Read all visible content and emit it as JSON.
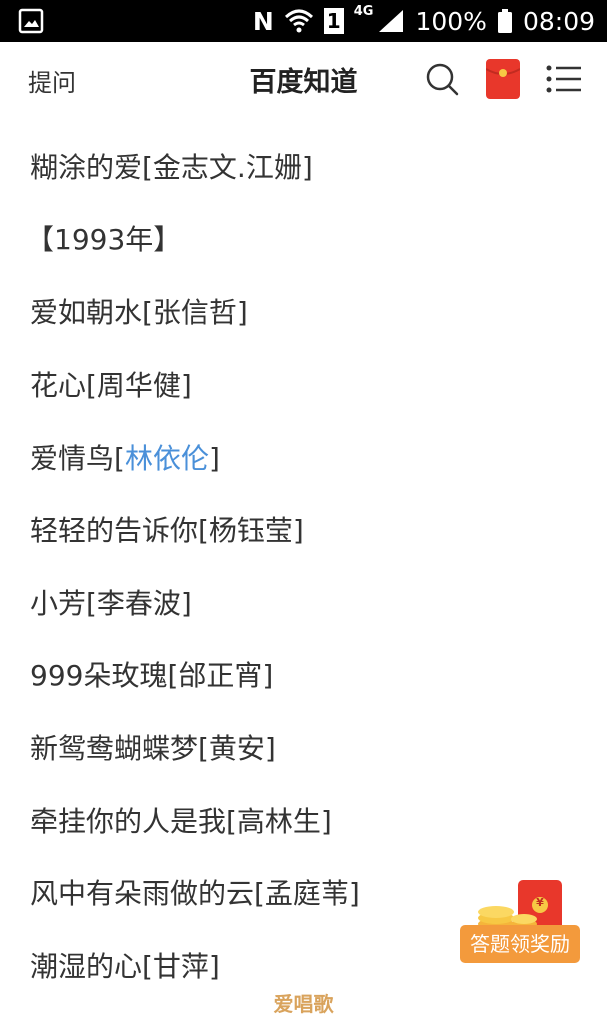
{
  "status_bar": {
    "battery": "100%",
    "time": "08:09",
    "network": "4G",
    "sim_slot": "1",
    "nfc": "N"
  },
  "header": {
    "ask_label": "提问",
    "title": "百度知道"
  },
  "lines": [
    {
      "text": "糊涂的爱[金志文.江姗]"
    },
    {
      "text": "【1993年】"
    },
    {
      "text": "爱如朝水[张信哲]"
    },
    {
      "text": "花心[周华健]"
    },
    {
      "text_before": "爱情鸟[",
      "link": "林依伦",
      "text_after": "]"
    },
    {
      "text": "轻轻的告诉你[杨钰莹]"
    },
    {
      "text": "小芳[李春波]"
    },
    {
      "text": "999朵玫瑰[邰正宵]"
    },
    {
      "text": "新鸳鸯蝴蝶梦[黄安]"
    },
    {
      "text": "牵挂你的人是我[高林生]"
    },
    {
      "text": "风中有朵雨做的云[孟庭苇]"
    },
    {
      "text": "潮湿的心[甘萍]"
    }
  ],
  "reward_button": {
    "label": "答题领奖励",
    "seal_glyph": "¥"
  },
  "watermark": "爱唱歌",
  "icons": {
    "status_left": "gallery-icon",
    "search": "search-icon",
    "red_packet": "red-packet-icon",
    "menu": "menu-icon"
  },
  "colors": {
    "link": "#4a90d9",
    "red_packet": "#e8372b",
    "reward_pill": "#f39a3c"
  }
}
